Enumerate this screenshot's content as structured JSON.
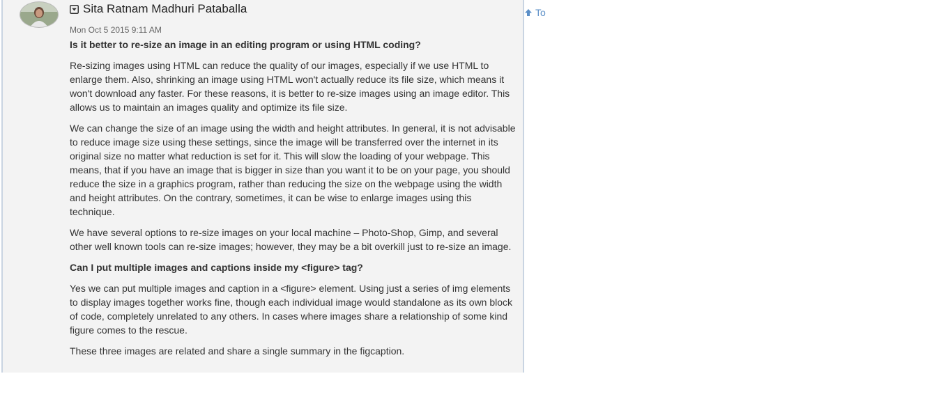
{
  "post": {
    "author": "Sita Ratnam Madhuri Pataballa",
    "timestamp": "Mon Oct 5 2015 9:11 AM",
    "blocks": [
      {
        "type": "question",
        "text": "Is it better to re-size an image in an editing program or using HTML coding?"
      },
      {
        "type": "para",
        "text": "Re-sizing images using HTML can reduce the quality of our images, especially if we use HTML to enlarge them. Also, shrinking an image using HTML won't actually reduce its file size, which means it won't download any faster. For these reasons, it is better to re-size images using an image editor. This allows us to maintain an images quality and optimize its file size."
      },
      {
        "type": "para",
        "text": "We can change the size of an image using the width and height attributes. In general, it is not advisable to reduce image size using these settings, since the image will be transferred over the internet in its original size no matter what reduction is set for it. This will slow the loading of your webpage. This means, that if you have an image that is bigger in size than you want it to be on your page, you should reduce the size in a graphics program, rather than reducing the size on the webpage using the width and height attributes. On the contrary, sometimes, it can be wise to enlarge images using this technique."
      },
      {
        "type": "para",
        "text": "We have several options to re-size images on your local machine – Photo-Shop, Gimp, and several other well known tools can re-size images; however, they may be a bit overkill just to re-size an image."
      },
      {
        "type": "question",
        "text": "Can I put multiple images and captions inside my <figure> tag?"
      },
      {
        "type": "para",
        "text": "Yes we can put multiple images and caption in a <figure> element. Using just a series of img elements to display images together works fine, though each individual image would standalone as its own block of code, completely unrelated to any others. In cases where images share a relationship of some kind figure comes to the rescue."
      },
      {
        "type": "para",
        "text": "These three images are related and share a single summary in the figcaption."
      }
    ]
  },
  "to_top": {
    "label": "To",
    "icon": "arrow-up-icon",
    "color": "#5b8fc7"
  },
  "icons": {
    "author_menu": "dropdown-box-icon"
  }
}
